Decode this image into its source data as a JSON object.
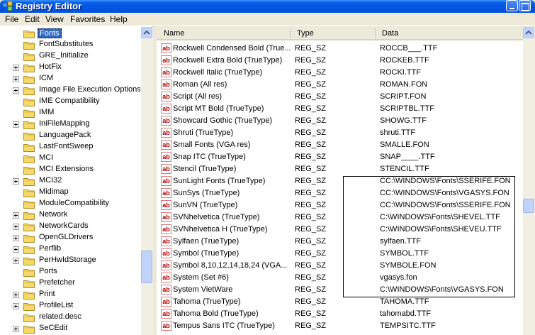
{
  "window": {
    "title": "Registry Editor",
    "icon": "registry-icon"
  },
  "menu": [
    "File",
    "Edit",
    "View",
    "Favorites",
    "Help"
  ],
  "tree": {
    "items": [
      {
        "label": "Fonts",
        "expander": false,
        "selected": true
      },
      {
        "label": "FontSubstitutes",
        "expander": false
      },
      {
        "label": "GRE_Initialize",
        "expander": false
      },
      {
        "label": "HotFix",
        "expander": true
      },
      {
        "label": "ICM",
        "expander": true
      },
      {
        "label": "Image File Execution Options",
        "expander": true
      },
      {
        "label": "IME Compatibility",
        "expander": false
      },
      {
        "label": "IMM",
        "expander": false
      },
      {
        "label": "IniFileMapping",
        "expander": true
      },
      {
        "label": "LanguagePack",
        "expander": false
      },
      {
        "label": "LastFontSweep",
        "expander": false
      },
      {
        "label": "MCI",
        "expander": false
      },
      {
        "label": "MCI Extensions",
        "expander": false
      },
      {
        "label": "MCI32",
        "expander": true
      },
      {
        "label": "Midimap",
        "expander": false
      },
      {
        "label": "ModuleCompatibility",
        "expander": false
      },
      {
        "label": "Network",
        "expander": true
      },
      {
        "label": "NetworkCards",
        "expander": true
      },
      {
        "label": "OpenGLDrivers",
        "expander": true
      },
      {
        "label": "Perflib",
        "expander": true
      },
      {
        "label": "PerHwIdStorage",
        "expander": true
      },
      {
        "label": "Ports",
        "expander": false
      },
      {
        "label": "Prefetcher",
        "expander": false
      },
      {
        "label": "Print",
        "expander": true
      },
      {
        "label": "ProfileList",
        "expander": true
      },
      {
        "label": "related.desc",
        "expander": false
      },
      {
        "label": "SeCEdit",
        "expander": true
      }
    ]
  },
  "list": {
    "columns": {
      "name": "Name",
      "type": "Type",
      "data": "Data"
    },
    "value_icon_text": "ab",
    "rows": [
      {
        "name": "Rockwell Condensed Bold (True...",
        "type": "REG_SZ",
        "data": "ROCCB___.TTF"
      },
      {
        "name": "Rockwell Extra Bold (TrueType)",
        "type": "REG_SZ",
        "data": "ROCKEB.TTF"
      },
      {
        "name": "Rockwell Italic (TrueType)",
        "type": "REG_SZ",
        "data": "ROCKI.TTF"
      },
      {
        "name": "Roman (All res)",
        "type": "REG_SZ",
        "data": "ROMAN.FON"
      },
      {
        "name": "Script (All res)",
        "type": "REG_SZ",
        "data": "SCRIPT.FON"
      },
      {
        "name": "Script MT Bold (TrueType)",
        "type": "REG_SZ",
        "data": "SCRIPTBL.TTF"
      },
      {
        "name": "Showcard Gothic (TrueType)",
        "type": "REG_SZ",
        "data": "SHOWG.TTF"
      },
      {
        "name": "Shruti (TrueType)",
        "type": "REG_SZ",
        "data": "shruti.TTF"
      },
      {
        "name": "Small Fonts (VGA res)",
        "type": "REG_SZ",
        "data": "SMALLE.FON"
      },
      {
        "name": "Snap ITC (TrueType)",
        "type": "REG_SZ",
        "data": "SNAP____.TTF"
      },
      {
        "name": "Stencil (TrueType)",
        "type": "REG_SZ",
        "data": "STENCIL.TTF"
      },
      {
        "name": "SunLight Fonts (TrueType)",
        "type": "REG_SZ",
        "data": "CC:\\WINDOWS\\Fonts\\SSERIFE.FON"
      },
      {
        "name": "SunSys (TrueType)",
        "type": "REG_SZ",
        "data": "CC:\\WINDOWS\\Fonts\\VGASYS.FON"
      },
      {
        "name": "SunVN (TrueType)",
        "type": "REG_SZ",
        "data": "CC:\\WINDOWS\\Fonts\\SSERIFE.FON"
      },
      {
        "name": "SVNhelvetica (TrueType)",
        "type": "REG_SZ",
        "data": "C:\\WINDOWS\\Fonts\\SHEVEL.TTF"
      },
      {
        "name": "SVNhelvetica H (TrueType)",
        "type": "REG_SZ",
        "data": "C:\\WINDOWS\\Fonts\\SHEVEU.TTF"
      },
      {
        "name": "Sylfaen (TrueType)",
        "type": "REG_SZ",
        "data": "sylfaen.TTF"
      },
      {
        "name": "Symbol (TrueType)",
        "type": "REG_SZ",
        "data": "SYMBOL.TTF"
      },
      {
        "name": "Symbol 8,10,12,14,18,24 (VGA...",
        "type": "REG_SZ",
        "data": "SYMBOLE.FON"
      },
      {
        "name": "System (Set #6)",
        "type": "REG_SZ",
        "data": "vgasys.fon"
      },
      {
        "name": "System VietWare",
        "type": "REG_SZ",
        "data": "C:\\WINDOWS\\Fonts\\VGASYS.FON"
      },
      {
        "name": "Tahoma (TrueType)",
        "type": "REG_SZ",
        "data": "TAHOMA.TTF"
      },
      {
        "name": "Tahoma Bold (TrueType)",
        "type": "REG_SZ",
        "data": "tahomabd.TTF"
      },
      {
        "name": "Tempus Sans ITC (TrueType)",
        "type": "REG_SZ",
        "data": "TEMPSITC.TTF"
      }
    ]
  },
  "colors": {
    "selection": "#316ac5",
    "titlebar": "#0054e3",
    "value_icon": "#b00000"
  }
}
